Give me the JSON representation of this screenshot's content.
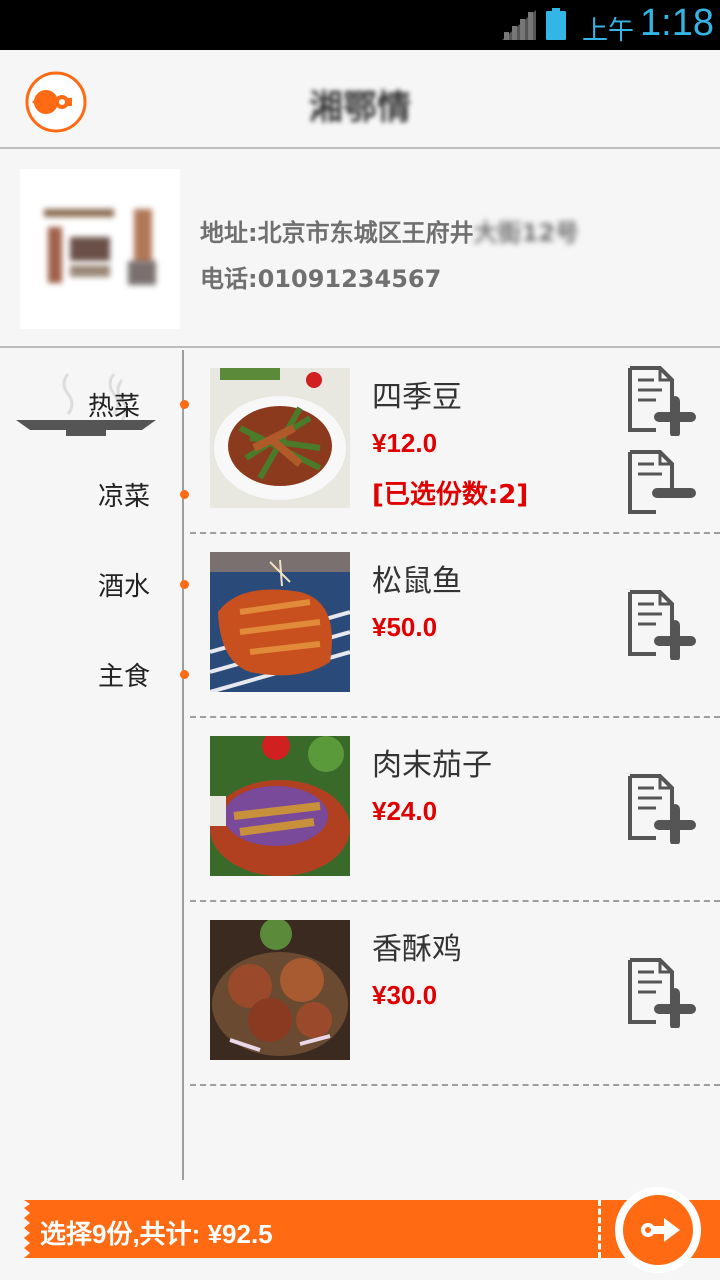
{
  "status_bar": {
    "ampm": "上午",
    "time": "1:18"
  },
  "header": {
    "title": "湘鄂情"
  },
  "restaurant": {
    "logo_text": "湘鄂情",
    "address_prefix": "地址:北京市东城区王府井",
    "address_blurred": "大街12号",
    "phone": "电话:01091234567"
  },
  "categories": [
    {
      "label": "热菜",
      "active": true
    },
    {
      "label": "凉菜",
      "active": false
    },
    {
      "label": "酒水",
      "active": false
    },
    {
      "label": "主食",
      "active": false
    }
  ],
  "dishes": [
    {
      "name": "四季豆",
      "price": "¥12.0",
      "selected": "[已选份数:2]"
    },
    {
      "name": "松鼠鱼",
      "price": "¥50.0",
      "selected": ""
    },
    {
      "name": "肉末茄子",
      "price": "¥24.0",
      "selected": ""
    },
    {
      "name": "香酥鸡",
      "price": "¥30.0",
      "selected": ""
    }
  ],
  "footer": {
    "summary": "选择9份,共计: ¥92.5"
  },
  "colors": {
    "accent": "#ff6a13",
    "price": "#e00000",
    "status_blue": "#33b5e5"
  },
  "icons": {
    "back": "back-arrow-icon",
    "add": "add-to-order-icon",
    "remove": "remove-from-order-icon",
    "submit": "forward-arrow-icon"
  }
}
